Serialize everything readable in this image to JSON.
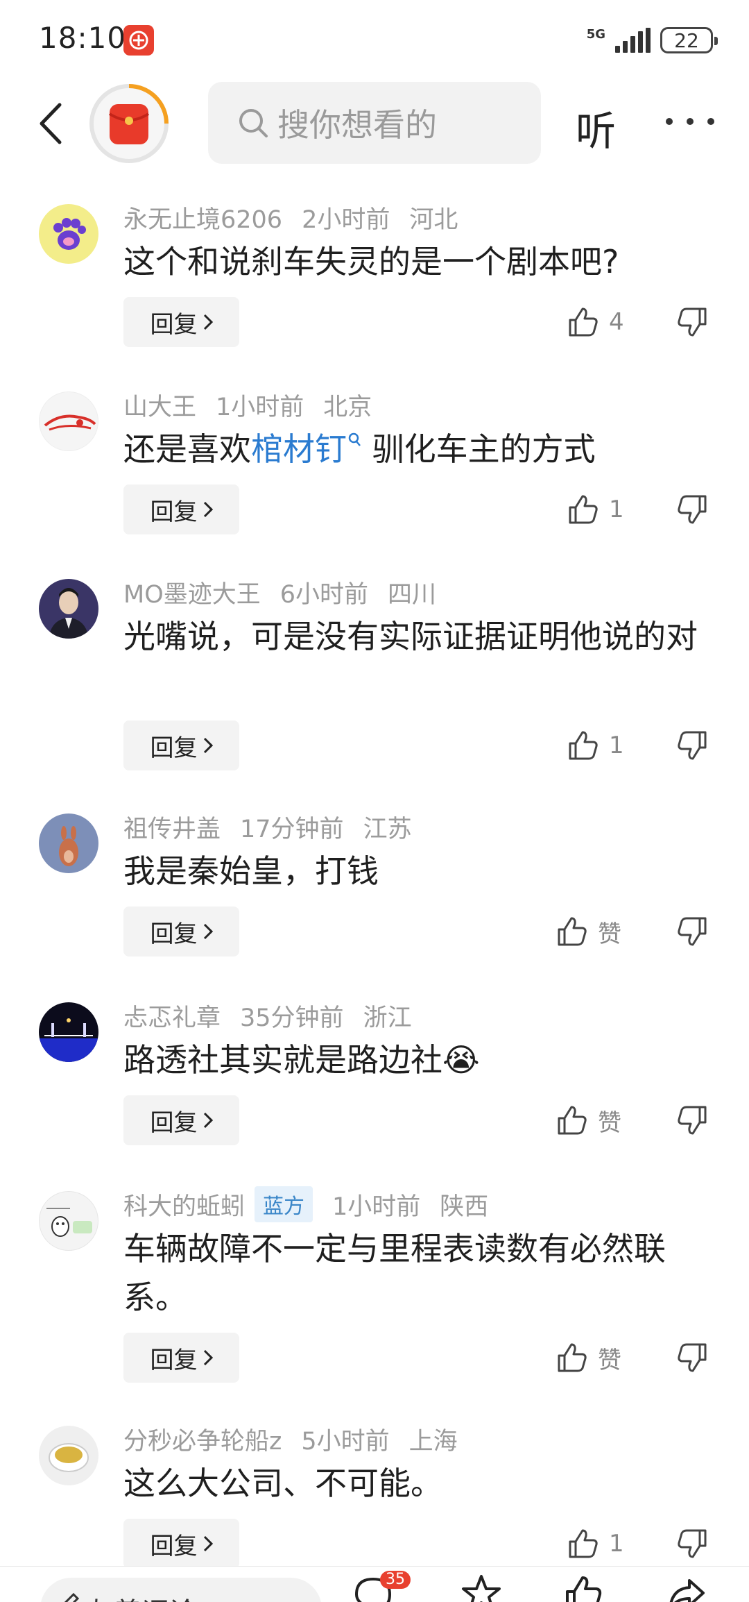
{
  "status_bar": {
    "time": "18:10",
    "network": "5G",
    "battery": "22"
  },
  "header": {
    "search_placeholder": "搜你想看的",
    "listen_label": "听"
  },
  "comments": [
    {
      "user": "永无止境6206",
      "time": "2小时前",
      "location": "河北",
      "text_before": "这个和说刹车失灵的是一个剧本吧?",
      "reply": "回复",
      "likes": "4"
    },
    {
      "user": "山大王",
      "time": "1小时前",
      "location": "北京",
      "text_before": "还是喜欢",
      "link": "棺材钉",
      "text_after": " 驯化车主的方式",
      "reply": "回复",
      "likes": "1"
    },
    {
      "user": "MO墨迹大王",
      "time": "6小时前",
      "location": "四川",
      "text_before": "光嘴说，可是没有实际证据证明他说的对",
      "reply": "回复",
      "likes": "1"
    },
    {
      "user": "祖传井盖",
      "time": "17分钟前",
      "location": "江苏",
      "text_before": "我是秦始皇，打钱",
      "reply": "回复",
      "likes": "赞"
    },
    {
      "user": "忐忑礼章",
      "time": "35分钟前",
      "location": "浙江",
      "text_before": "路透社其实就是路边社😭",
      "reply": "回复",
      "likes": "赞"
    },
    {
      "user": "科大的蚯蚓",
      "badge": "蓝方",
      "time": "1小时前",
      "location": "陕西",
      "text_before": "车辆故障不一定与里程表读数有必然联系。",
      "reply": "回复",
      "likes": "赞"
    },
    {
      "user": "分秒必争轮船z",
      "time": "5小时前",
      "location": "上海",
      "text_before": "这么大公司、不可能。",
      "reply": "回复",
      "likes": "1"
    }
  ],
  "bottom_bar": {
    "input_placeholder": "友善评论",
    "comment_count": "35"
  },
  "colors": {
    "accent_red": "#e8402f",
    "link_blue": "#2a7bd0",
    "meta_gray": "#9b9b9b"
  }
}
